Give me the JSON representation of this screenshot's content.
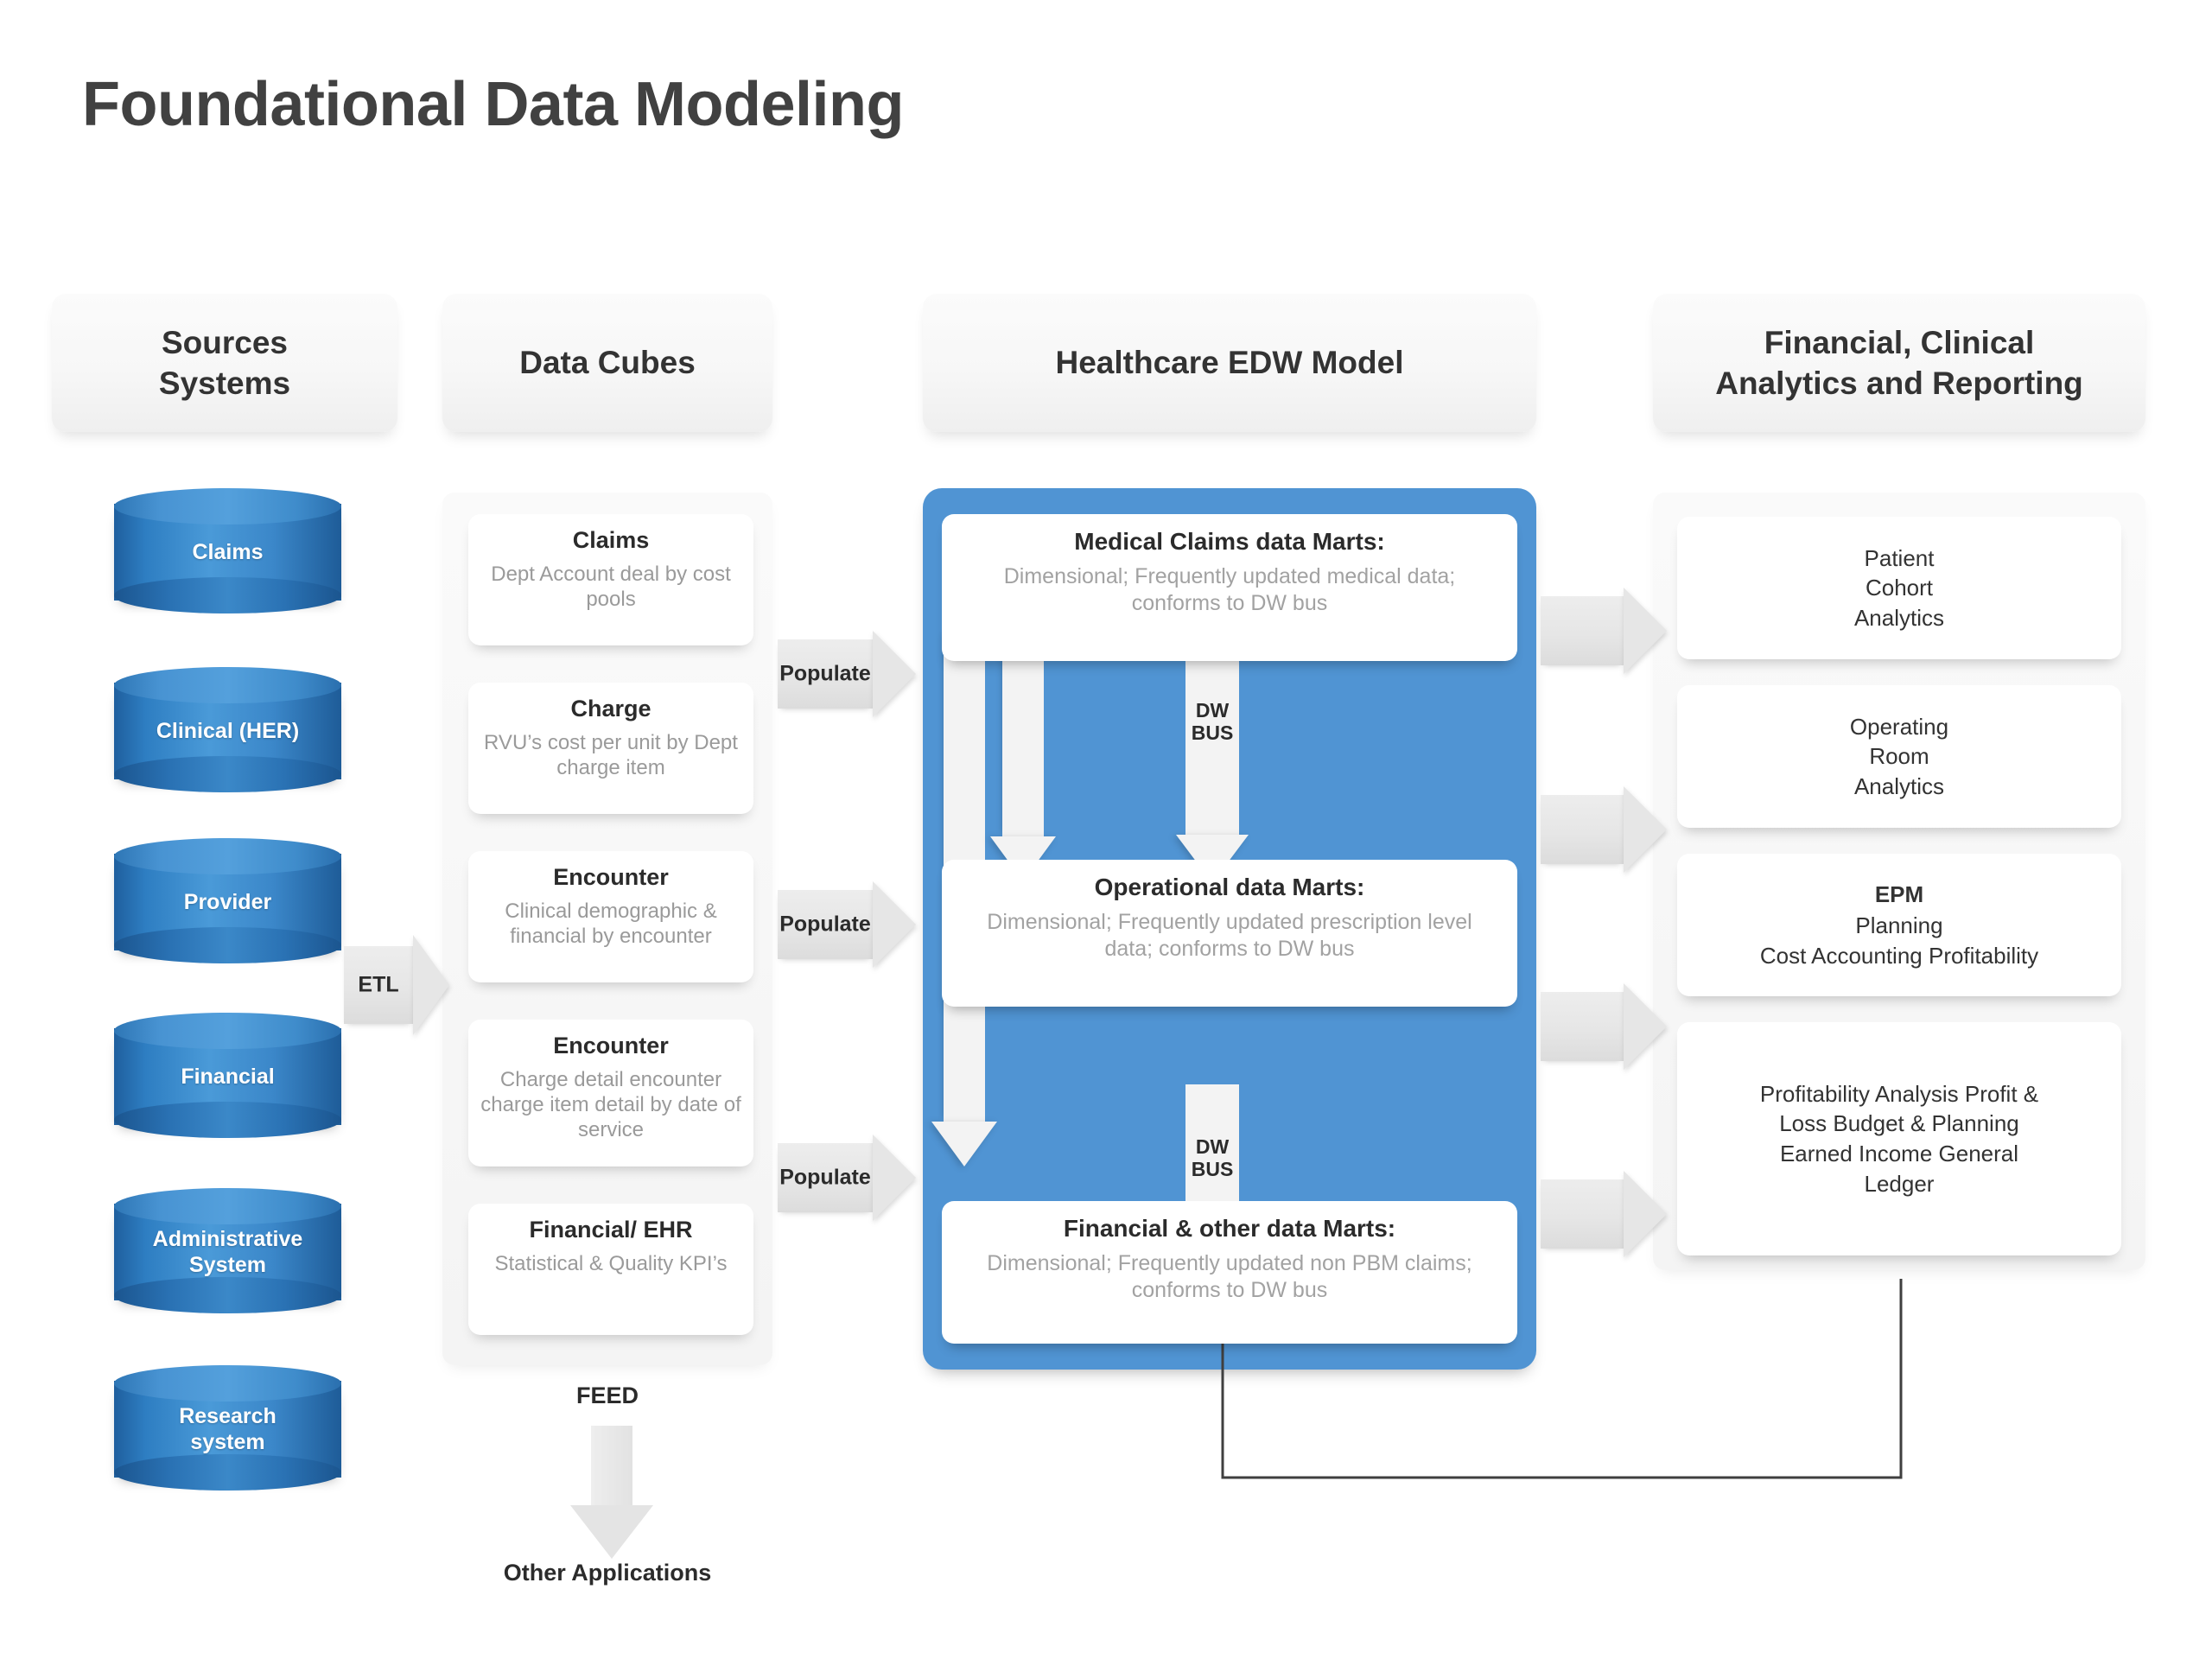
{
  "title": "Foundational Data Modeling",
  "columns": {
    "sources": "Sources\nSystems",
    "sources_line1": "Sources",
    "sources_line2": "Systems",
    "cubes": "Data Cubes",
    "edw": "Healthcare EDW Model",
    "analytics_line1": "Financial, Clinical",
    "analytics_line2": "Analytics and Reporting"
  },
  "source_systems": [
    {
      "label": "Claims"
    },
    {
      "label": "Clinical (HER)"
    },
    {
      "label": "Provider"
    },
    {
      "label": "Financial"
    },
    {
      "label": "Administrative\nSystem",
      "l1": "Administrative",
      "l2": "System"
    },
    {
      "label": "Research\nsystem",
      "l1": "Research",
      "l2": "system"
    }
  ],
  "data_cubes": [
    {
      "title": "Claims",
      "subtitle": "Dept Account deal by cost pools"
    },
    {
      "title": "Charge",
      "subtitle": "RVU’s cost per unit by Dept charge item"
    },
    {
      "title": "Encounter",
      "subtitle": "Clinical demographic & financial by encounter"
    },
    {
      "title": "Encounter",
      "subtitle": "Charge detail encounter charge item detail by date of service"
    },
    {
      "title": "Financial/ EHR",
      "subtitle": "Statistical & Quality KPI’s"
    }
  ],
  "data_marts": [
    {
      "title": "Medical Claims data Marts:",
      "subtitle": "Dimensional; Frequently updated medical data; conforms to DW bus"
    },
    {
      "title": "Operational data Marts:",
      "subtitle": "Dimensional; Frequently updated prescription level data; conforms to DW bus"
    },
    {
      "title": "Financial & other data Marts:",
      "subtitle": "Dimensional; Frequently updated non PBM claims; conforms to DW bus"
    }
  ],
  "analytics": [
    {
      "bold": "",
      "body": "Patient\nCohort\nAnalytics",
      "lines": [
        "Patient",
        "Cohort",
        "Analytics"
      ]
    },
    {
      "bold": "",
      "body": "Operating\nRoom\nAnalytics",
      "lines": [
        "Operating",
        "Room",
        "Analytics"
      ]
    },
    {
      "bold": "EPM",
      "body": "Planning\nCost Accounting Profitability",
      "lines": [
        "Planning",
        "Cost Accounting Profitability"
      ]
    },
    {
      "bold": "",
      "body": "Profitability Analysis Profit & Loss Budget & Planning Earned Income General Ledger",
      "lines": [
        "Profitability Analysis Profit &",
        "Loss Budget & Planning",
        "Earned Income General",
        "Ledger"
      ]
    }
  ],
  "connectors": {
    "etl": "ETL",
    "populate": "Populate",
    "dw_bus_line1": "DW",
    "dw_bus_line2": "BUS",
    "feed": "FEED",
    "other_applications": "Other Applications"
  },
  "colors": {
    "edw_panel": "#5094d3",
    "cylinder": "#3b87c9",
    "title_text": "#414141",
    "subtitle_text": "#9a9a9a",
    "arrow_gray": "#e6e6e6"
  }
}
